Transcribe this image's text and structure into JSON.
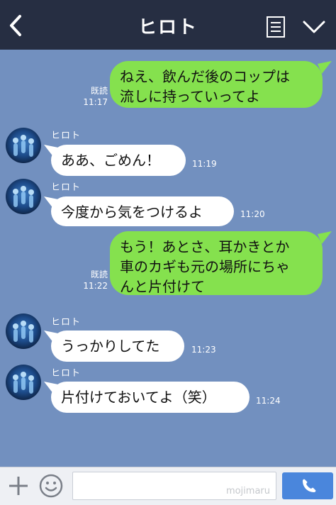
{
  "header": {
    "title": "ヒロト",
    "icons": {
      "back": "chevron-left-icon",
      "menu": "document-list-icon",
      "more": "chevron-down-icon"
    }
  },
  "messages": [
    {
      "from": "me",
      "text": "ねえ、飲んだ後のコップは\n流しに持っていってよ",
      "read_label": "既読",
      "time": "11:17"
    },
    {
      "from": "other",
      "sender": "ヒロト",
      "text": "ああ、ごめん！",
      "time": "11:19"
    },
    {
      "from": "other",
      "sender": "ヒロト",
      "text": "今度から気をつけるよ",
      "time": "11:20"
    },
    {
      "from": "me",
      "text": "もう！あとさ、耳かきとか\n車のカギも元の場所にちゃ\nんと片付けて",
      "read_label": "既読",
      "time": "11:22"
    },
    {
      "from": "other",
      "sender": "ヒロト",
      "text": "うっかりしてた",
      "time": "11:23"
    },
    {
      "from": "other",
      "sender": "ヒロト",
      "text": "片付けておいてよ（笑）",
      "time": "11:24"
    }
  ],
  "footer": {
    "input_value": "",
    "watermark": "mojimaru",
    "icons": {
      "add": "plus-icon",
      "sticker": "smiley-icon",
      "call": "phone-icon"
    }
  },
  "colors": {
    "background": "#7290bf",
    "header": "#262e42",
    "my_bubble": "#85e14e",
    "their_bubble": "#ffffff",
    "call_button": "#4a86dc"
  }
}
